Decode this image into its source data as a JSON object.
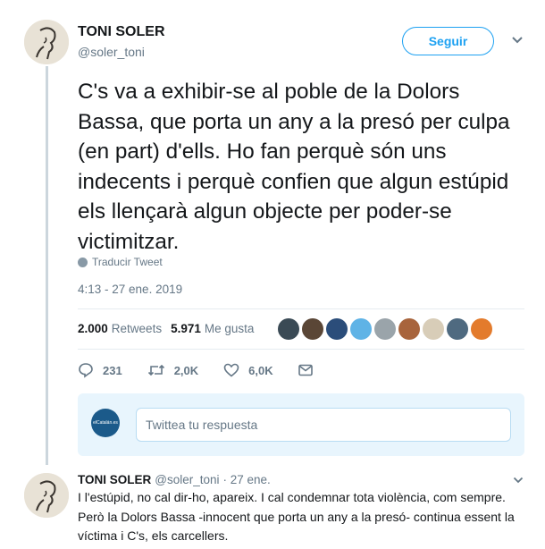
{
  "tweet": {
    "author_name": "TONI SOLER",
    "author_handle": "@soler_toni",
    "follow_label": "Seguir",
    "text": "C's va a exhibir-se al poble de la Dolors Bassa, que porta un any a la presó per culpa (en part) d'ells. Ho fan perquè són uns indecents i perquè confien que algun estúpid els llençarà algun objecte per poder-se victimitzar.",
    "translate_label": "Traducir Tweet",
    "timestamp": "4:13 - 27 ene. 2019"
  },
  "stats": {
    "retweets_count": "2.000",
    "retweets_label": "Retweets",
    "likes_count": "5.971",
    "likes_label": "Me gusta"
  },
  "likers": [
    {
      "color": "#3a4a55",
      "icon": "liker-avatar"
    },
    {
      "color": "#5a4636",
      "icon": "liker-avatar"
    },
    {
      "color": "#2b4d7a",
      "icon": "liker-avatar"
    },
    {
      "color": "#5fb3e6",
      "icon": "liker-avatar"
    },
    {
      "color": "#9aa4aa",
      "icon": "liker-avatar"
    },
    {
      "color": "#a8643c",
      "icon": "liker-avatar"
    },
    {
      "color": "#d8cdb8",
      "icon": "liker-avatar"
    },
    {
      "color": "#4f6a80",
      "icon": "liker-avatar"
    },
    {
      "color": "#e37b2c",
      "icon": "liker-avatar"
    }
  ],
  "actions": {
    "reply_count": "231",
    "retweet_count": "2,0K",
    "like_count": "6,0K"
  },
  "reply_box": {
    "placeholder": "Twittea tu respuesta",
    "avatar_label": "elCatalán.es"
  },
  "reply": {
    "author_name": "TONI SOLER",
    "author_handle": "@soler_toni",
    "time": "· 27 ene.",
    "text": "I l'estúpid, no cal dir-ho, apareix. I cal condemnar tota violència, com sempre. Però la Dolors Bassa -innocent que porta un any a la presó- continua essent la víctima i C's, els carcellers."
  },
  "colors": {
    "accent": "#1da1f2",
    "secondary_text": "#657786",
    "primary_text": "#14171a"
  }
}
